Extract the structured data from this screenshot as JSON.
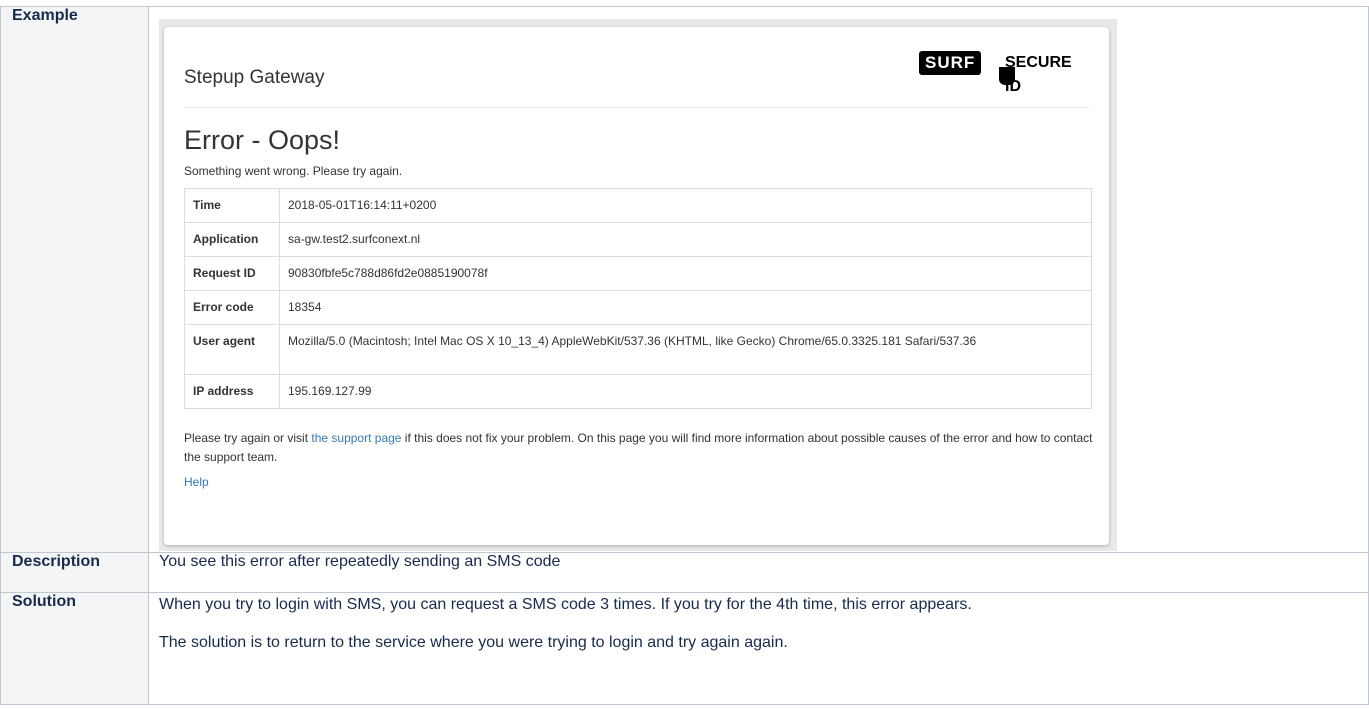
{
  "rows": {
    "example_label": "Example",
    "description_label": "Description",
    "description_text": "You see this error after repeatedly sending an SMS code",
    "solution_label": "Solution",
    "solution_p1": "When you try to login with SMS, you can request a SMS code 3 times. If you try for the 4th time, this error appears.",
    "solution_p2": "The solution is to return to the service where you were trying to login and try again again."
  },
  "screenshot": {
    "gateway_title": "Stepup Gateway",
    "logo_surf": "SURF",
    "logo_secure": "SECURE ID",
    "error_title": "Error - Oops!",
    "error_subtitle": "Something went wrong. Please try again.",
    "info": [
      {
        "key": "Time",
        "value": "2018-05-01T16:14:11+0200"
      },
      {
        "key": "Application",
        "value": "sa-gw.test2.surfconext.nl"
      },
      {
        "key": "Request ID",
        "value": "90830fbfe5c788d86fd2e0885190078f"
      },
      {
        "key": "Error code",
        "value": "18354"
      },
      {
        "key": "User agent",
        "value": "Mozilla/5.0 (Macintosh; Intel Mac OS X 10_13_4) AppleWebKit/537.36 (KHTML, like Gecko) Chrome/65.0.3325.181 Safari/537.36"
      },
      {
        "key": "IP address",
        "value": "195.169.127.99"
      }
    ],
    "footer_before": "Please try again or visit ",
    "footer_link": "the support page",
    "footer_after": " if this does not fix your problem. On this page you will find more information about possible causes of the error and how to contact the support team.",
    "help_link": "Help"
  }
}
